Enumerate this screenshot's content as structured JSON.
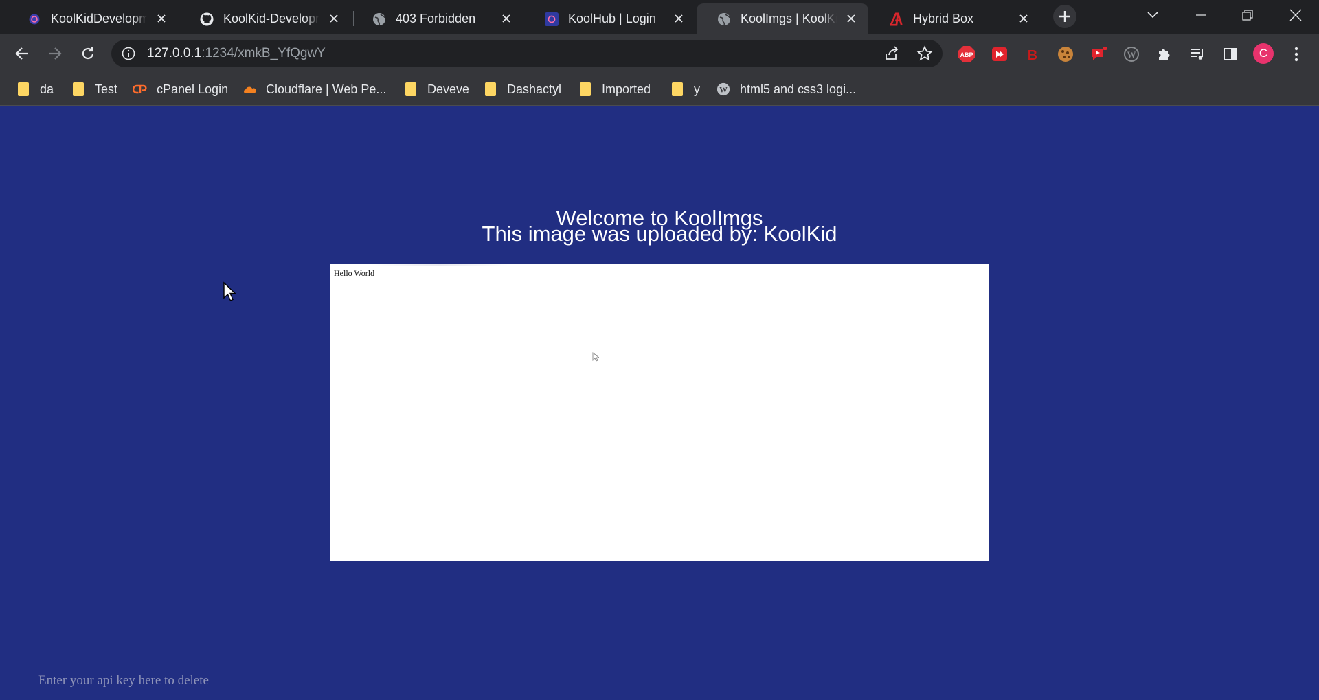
{
  "browser": {
    "tabs": [
      {
        "title": "KoolKidDevelopme",
        "icon": "koolkid-icon",
        "active": false
      },
      {
        "title": "KoolKid-Developme",
        "icon": "github-icon",
        "active": false
      },
      {
        "title": "403 Forbidden",
        "icon": "globe-icon",
        "active": false
      },
      {
        "title": "KoolHub | Login",
        "icon": "koolkid-icon",
        "active": false
      },
      {
        "title": "KoolImgs | KoolKid",
        "icon": "globe-icon",
        "active": true
      },
      {
        "title": "Hybrid Box",
        "icon": "hybrid-a-icon",
        "active": false
      }
    ],
    "address": {
      "host": "127.0.0.1",
      "rest": ":1234/xmkB_YfQgwY"
    },
    "profile_initial": "C",
    "extensions": [
      "adblock-plus-icon",
      "red-play-icon",
      "red-b-icon",
      "cookie-icon",
      "red-extension-icon",
      "wordpress-icon",
      "puzzle-icon",
      "media-queue-icon",
      "side-panel-icon"
    ]
  },
  "bookmarks": [
    {
      "label": "da",
      "icon": "folder-icon"
    },
    {
      "label": "Test",
      "icon": "folder-icon"
    },
    {
      "label": "cPanel Login",
      "icon": "cpanel-icon"
    },
    {
      "label": "Cloudflare | Web Pe...",
      "icon": "cloudflare-icon"
    },
    {
      "label": "Deveve",
      "icon": "folder-icon"
    },
    {
      "label": "Dashactyl",
      "icon": "folder-icon"
    },
    {
      "label": "Imported",
      "icon": "folder-icon"
    },
    {
      "label": "y",
      "icon": "folder-icon"
    },
    {
      "label": "html5 and css3 logi...",
      "icon": "wordpress-icon"
    }
  ],
  "page": {
    "heading": "Welcome to KoolImgs",
    "uploader_line": "This image was uploaded by: KoolKid",
    "image_text": "Hello World",
    "api_placeholder": "Enter your api key here to delete",
    "background_color": "#212e82"
  }
}
